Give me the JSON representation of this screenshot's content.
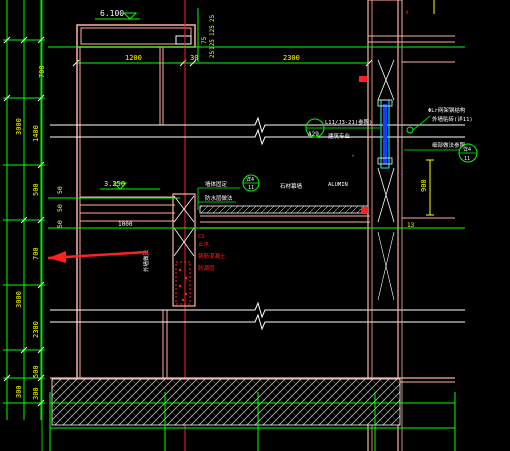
{
  "drawing": {
    "elevations": {
      "top": "6.100",
      "mid": "3.250"
    },
    "dims_left_vertical": [
      "700",
      "3000",
      "1400",
      "500",
      "700",
      "3000",
      "2300",
      "500",
      "300",
      "300"
    ],
    "dims_left_small": [
      "50",
      "50",
      "50"
    ],
    "dims_top_horizontal": [
      "1200",
      "30",
      "2300"
    ],
    "dims_top_right_vertical": [
      "25",
      "125",
      "75",
      "125",
      "25"
    ],
    "dim_1000": "1000",
    "dim_900": "900",
    "dim_13": "13",
    "callouts": [
      {
        "id": "A29",
        "text": "L11/J3-21(参照)",
        "sub": "建筑专业"
      },
      {
        "id": "11",
        "top": "详4",
        "text": "外墙贴砖(参照)"
      },
      {
        "id": "11",
        "top": "详4",
        "text": "细部做法参照"
      }
    ],
    "notes": {
      "n1": "ΦLr网架钢结构",
      "n2": "外墙贴砖(详11)",
      "n3": "墙体固定",
      "n4": "防水层做法",
      "n5": "石材幕墙",
      "n6": "止水",
      "n7": "钢筋混凝土",
      "n8": "防潮层",
      "n9": "ALUMIN",
      "n10": "外墙做法",
      "n11": "C1"
    }
  },
  "colors": {
    "bg": "#000000",
    "white": "#ffffff",
    "green": "#00ff00",
    "red": "#ff2020",
    "pink": "#ffb0a0",
    "cyan": "#00ffff",
    "yellow": "#ffff00",
    "magenta": "#ff40ff",
    "gray": "#c0c0c0",
    "arrow": "#ff2020"
  }
}
